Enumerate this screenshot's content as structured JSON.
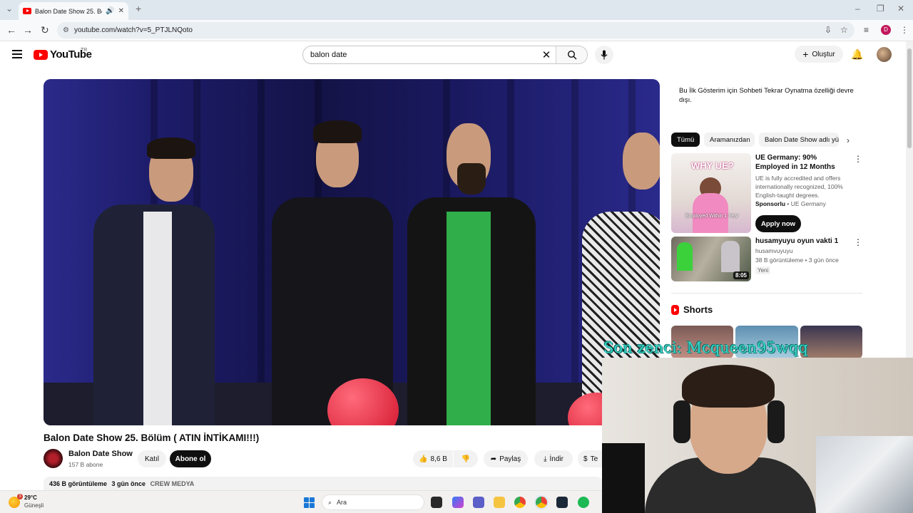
{
  "browser": {
    "tab_title": "Balon Date Show 25. Bölüm",
    "url": "youtube.com/watch?v=5_PTJLNQoto",
    "profile_initial": "D"
  },
  "masthead": {
    "logo_text": "YouTube",
    "region": "TR",
    "search_value": "balon date",
    "create_label": "Oluştur"
  },
  "video": {
    "title": "Balon Date Show 25. Bölüm ( ATIN İNTİKAMI!!!)",
    "channel_name": "Balon Date Show",
    "channel_subs": "157 B abone",
    "join_label": "Katıl",
    "subscribe_label": "Abone ol",
    "likes": "8,6 B",
    "share_label": "Paylaş",
    "download_label": "İndir",
    "extra_label": "Te",
    "views": "436 B görüntüleme",
    "age": "3 gün önce",
    "tag": "CREW MEDYA"
  },
  "sidebar": {
    "notice": "Bu İlk Gösterim için Sohbeti Tekrar Oynatma özelliği devre dışı.",
    "chips": [
      "Tümü",
      "Aramanızdan",
      "Balon Date Show adlı yü"
    ],
    "ad": {
      "title": "UE Germany: 90% Employed in 12 Months",
      "description": "UE is fully accredited and offers internationally recognized, 100% English-taught degrees.",
      "sponsored": "Sponsorlu",
      "advertiser": "UE Germany",
      "cta": "Apply now",
      "thumb_heading": "WHY UE?",
      "thumb_caption": "Employed Within 1 Year"
    },
    "rec": {
      "title": "husamyuyu oyun vakti 1",
      "channel": "husamvuyuyu",
      "meta": "38 B görüntüleme • 3 gün önce",
      "badge": "Yeni",
      "duration": "8:05"
    },
    "shorts_label": "Shorts"
  },
  "overlay_text": "Son zenci: Mcqueen95wqq",
  "taskbar": {
    "temp": "29°C",
    "weather": "Güneşli",
    "weather_badge": "3",
    "search_placeholder": "Ara"
  }
}
